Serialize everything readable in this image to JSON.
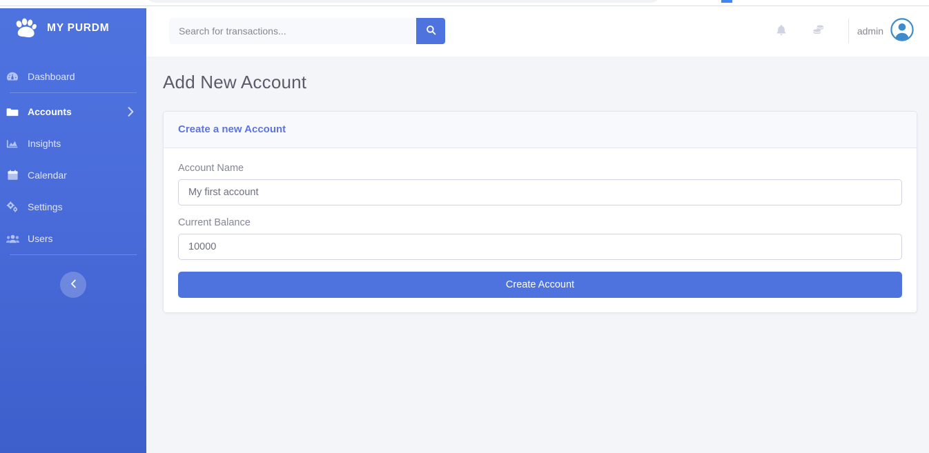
{
  "sidebar": {
    "brand": {
      "text": "MY PURDM",
      "icon": "paw-icon"
    },
    "items": [
      {
        "label": "Dashboard",
        "icon": "tachometer-icon",
        "active": false,
        "has_chevron": false
      },
      {
        "label": "Accounts",
        "icon": "folder-icon",
        "active": true,
        "has_chevron": true
      },
      {
        "label": "Insights",
        "icon": "chart-area-icon",
        "active": false,
        "has_chevron": false
      },
      {
        "label": "Calendar",
        "icon": "calendar-icon",
        "active": false,
        "has_chevron": false
      },
      {
        "label": "Settings",
        "icon": "cogs-icon",
        "active": false,
        "has_chevron": false
      },
      {
        "label": "Users",
        "icon": "users-icon",
        "active": false,
        "has_chevron": false
      }
    ],
    "toggle": {
      "icon": "chevron-left-icon"
    }
  },
  "topbar": {
    "search": {
      "placeholder": "Search for transactions...",
      "value": "",
      "button_icon": "search-icon"
    },
    "notifications_icon": "bell-icon",
    "coins_icon": "coins-icon",
    "user": {
      "name": "admin",
      "avatar_icon": "user-avatar-icon"
    }
  },
  "main": {
    "page_title": "Add New Account",
    "card": {
      "header": "Create a new Account",
      "fields": [
        {
          "label": "Account Name",
          "value": "My first account",
          "placeholder": "Account Name"
        },
        {
          "label": "Current Balance",
          "value": "10000",
          "placeholder": "Current Balance"
        }
      ],
      "submit_label": "Create Account"
    }
  },
  "colors": {
    "brand_blue": "#4e73df",
    "sidebar_gradient_start": "#4e73df",
    "sidebar_gradient_end": "#3d5fcc",
    "card_header_text": "#5d74e0",
    "page_title_text": "#5a5c69",
    "content_bg": "#f4f5f9",
    "muted_text": "#858796",
    "border": "#e3e6f0"
  }
}
